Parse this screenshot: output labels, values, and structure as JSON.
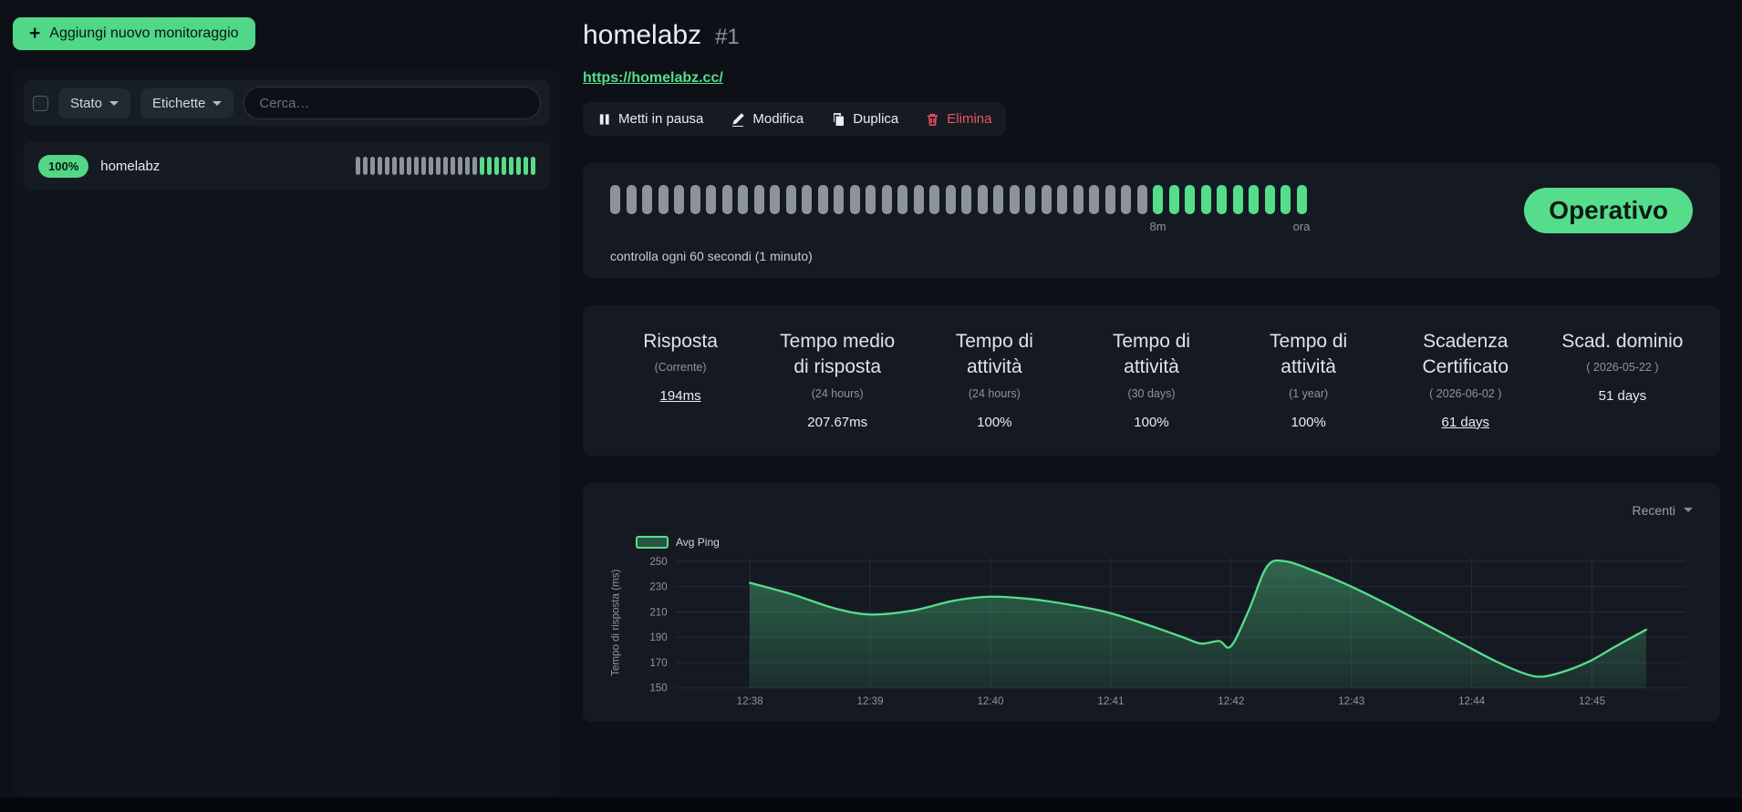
{
  "colors": {
    "green": "#56dd8c",
    "red": "#ef5366",
    "bar_gray": "#8d939b",
    "card_bg": "#151a22",
    "page_bg": "#0d1117"
  },
  "sidebar": {
    "add_button": "Aggiungi nuovo monitoraggio",
    "filters": {
      "status_label": "Stato",
      "labels_label": "Etichette",
      "search_placeholder": "Cerca…"
    },
    "monitor": {
      "uptime_badge": "100%",
      "name": "homelabz",
      "heartbeat": {
        "gray": 17,
        "green": 8
      }
    }
  },
  "header": {
    "title": "homelabz",
    "monitor_id": "#1",
    "url": "https://homelabz.cc/"
  },
  "actions": {
    "pause": "Metti in pausa",
    "edit": "Modifica",
    "clone": "Duplica",
    "delete": "Elimina"
  },
  "heartbeat_section": {
    "bars": {
      "gray": 34,
      "green": 10
    },
    "time_start": "8m",
    "time_end": "ora",
    "status_badge": "Operativo",
    "check_interval": "controlla ogni 60 secondi (1 minuto)"
  },
  "stats": [
    {
      "title": "Risposta",
      "subtitle": "(Corrente)",
      "value": "194ms",
      "underline": true
    },
    {
      "title": "Tempo medio di risposta",
      "subtitle": "(24 hours)",
      "value": "207.67ms",
      "underline": false
    },
    {
      "title": "Tempo di attività",
      "subtitle": "(24 hours)",
      "value": "100%",
      "underline": false
    },
    {
      "title": "Tempo di attività",
      "subtitle": "(30 days)",
      "value": "100%",
      "underline": false
    },
    {
      "title": "Tempo di attività",
      "subtitle": "(1 year)",
      "value": "100%",
      "underline": false
    },
    {
      "title": "Scadenza Certificato",
      "subtitle": "( 2026-06-02 )",
      "value": "61 days",
      "underline": true
    },
    {
      "title": "Scad. dominio",
      "subtitle": "( 2026-05-22 )",
      "value": "51 days",
      "underline": false
    }
  ],
  "chart_card": {
    "period_select": "Recenti"
  },
  "chart_data": {
    "type": "area",
    "title": "",
    "legend_position": "top-left",
    "grid": true,
    "ylabel": "Tempo di risposta (ms)",
    "yticks": [
      150,
      170,
      190,
      210,
      230,
      250
    ],
    "ylim": [
      150,
      253
    ],
    "xticks": [
      "12:38",
      "12:39",
      "12:40",
      "12:41",
      "12:42",
      "12:43",
      "12:44",
      "12:45"
    ],
    "xlim_minutes": [
      -0.62,
      7.78
    ],
    "series": [
      {
        "name": "Avg Ping",
        "color": "#56dd8c",
        "points": [
          [
            0.0,
            233
          ],
          [
            0.35,
            224
          ],
          [
            0.7,
            213
          ],
          [
            1.0,
            208
          ],
          [
            1.35,
            211
          ],
          [
            1.7,
            219
          ],
          [
            2.0,
            222
          ],
          [
            2.35,
            220
          ],
          [
            2.7,
            215
          ],
          [
            3.0,
            209
          ],
          [
            3.3,
            200
          ],
          [
            3.6,
            190
          ],
          [
            3.75,
            185
          ],
          [
            3.9,
            187
          ],
          [
            4.0,
            183
          ],
          [
            4.15,
            212
          ],
          [
            4.3,
            246
          ],
          [
            4.45,
            250
          ],
          [
            4.7,
            242
          ],
          [
            5.0,
            230
          ],
          [
            5.3,
            216
          ],
          [
            5.6,
            201
          ],
          [
            5.9,
            186
          ],
          [
            6.2,
            171
          ],
          [
            6.45,
            161
          ],
          [
            6.6,
            159
          ],
          [
            6.8,
            164
          ],
          [
            7.0,
            172
          ],
          [
            7.2,
            183
          ],
          [
            7.45,
            196
          ]
        ]
      }
    ]
  }
}
